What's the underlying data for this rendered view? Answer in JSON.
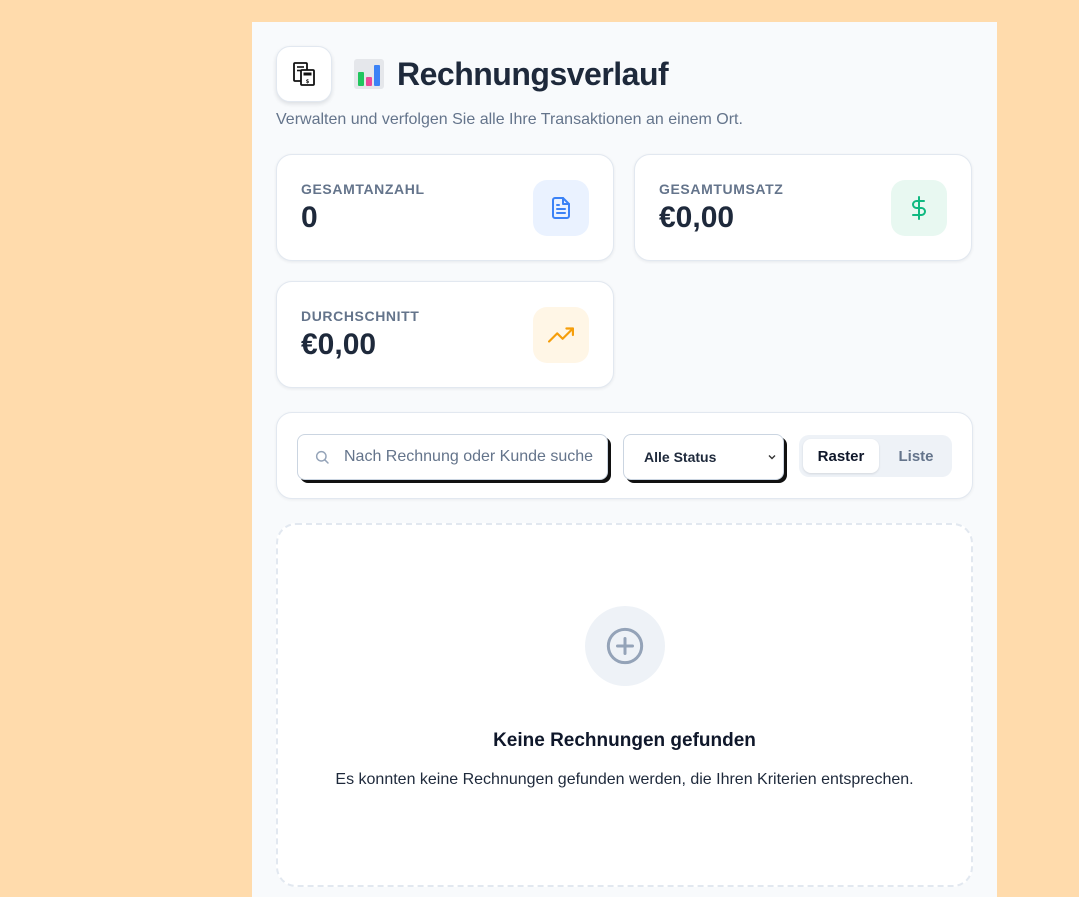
{
  "header": {
    "title": "Rechnungsverlauf",
    "subtitle": "Verwalten und verfolgen Sie alle Ihre Transaktionen an einem Ort.",
    "logo_icon": "receipt-icon",
    "title_emoji_icon": "bar-chart-icon"
  },
  "stats": [
    {
      "label": "GESAMTANZAHL",
      "value": "0",
      "icon": "document-icon",
      "accent": "#3b82f6",
      "icon_bg": "#eaf2ff"
    },
    {
      "label": "GESAMTUMSATZ",
      "value": "€0,00",
      "icon": "dollar-icon",
      "accent": "#10b981",
      "icon_bg": "#e8f8f1"
    },
    {
      "label": "DURCHSCHNITT",
      "value": "€0,00",
      "icon": "trending-up-icon",
      "accent": "#f59e0b",
      "icon_bg": "#fff6e6"
    }
  ],
  "filters": {
    "search_placeholder": "Nach Rechnung oder Kunde suchen...",
    "search_value": "",
    "status_selected": "Alle Status",
    "view_options": [
      "Raster",
      "Liste"
    ],
    "view_active": "Raster"
  },
  "empty_state": {
    "icon": "plus-circle-icon",
    "title": "Keine Rechnungen gefunden",
    "text": "Es konnten keine Rechnungen gefunden werden, die Ihren Kriterien entsprechen."
  },
  "colors": {
    "background": "#ffdbac",
    "panel": "#f8fafc",
    "text_primary": "#1e293b",
    "text_muted": "#64748b"
  }
}
